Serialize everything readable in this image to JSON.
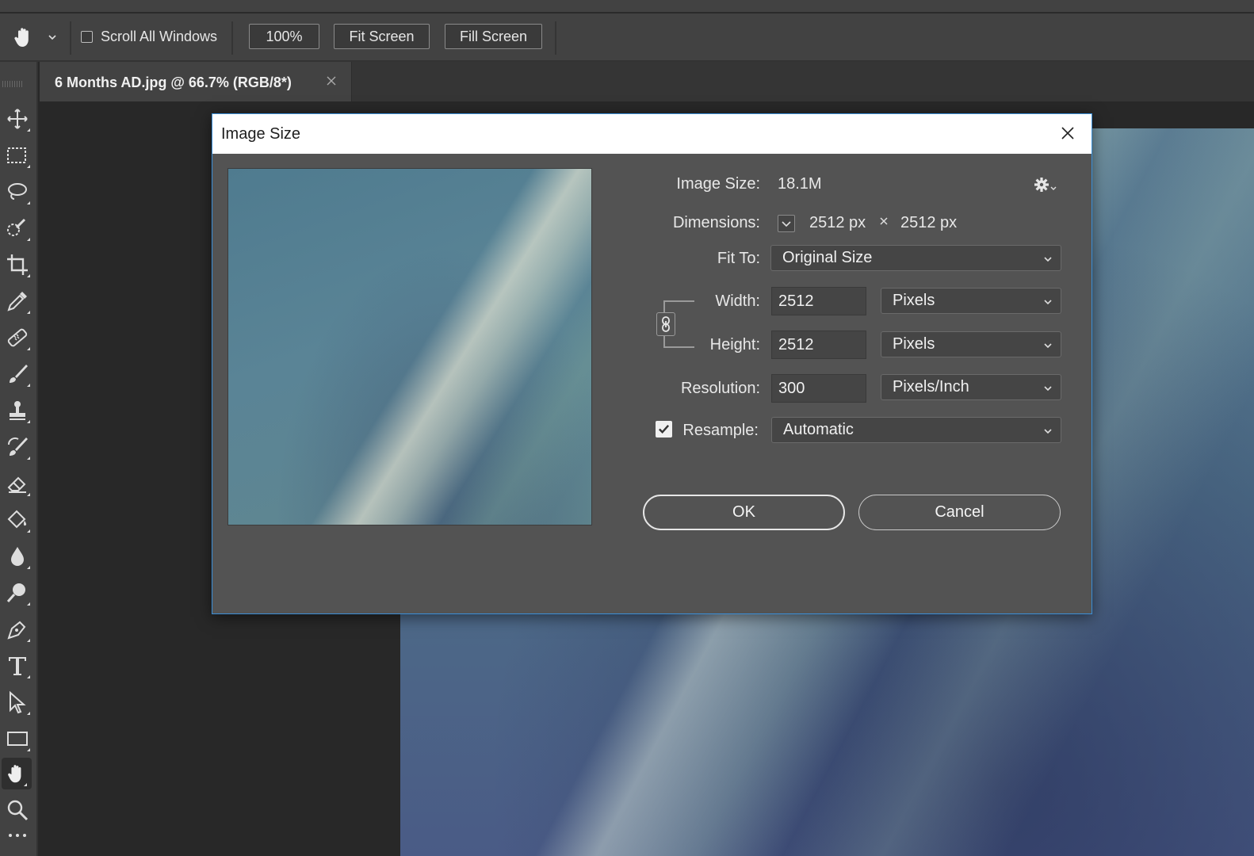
{
  "options_bar": {
    "scroll_all_label": "Scroll All Windows",
    "zoom_100_label": "100%",
    "fit_screen_label": "Fit Screen",
    "fill_screen_label": "Fill Screen"
  },
  "document_tab": {
    "title": "6 Months AD.jpg @ 66.7% (RGB/8*)"
  },
  "toolbar": {
    "tools": [
      "move-icon",
      "marquee-icon",
      "lasso-icon",
      "quick-select-icon",
      "crop-icon",
      "eyedropper-icon",
      "healing-icon",
      "brush-icon",
      "stamp-icon",
      "history-brush-icon",
      "eraser-icon",
      "paint-bucket-icon",
      "blur-icon",
      "dodge-icon",
      "pen-icon",
      "type-icon",
      "path-select-icon",
      "rectangle-icon",
      "hand-icon",
      "zoom-icon"
    ],
    "active_tool": "hand-icon"
  },
  "dialog": {
    "title": "Image Size",
    "image_size_label": "Image Size:",
    "image_size_value": "18.1M",
    "dimensions_label": "Dimensions:",
    "dimensions_width": "2512 px",
    "dimensions_height": "2512 px",
    "fit_to_label": "Fit To:",
    "fit_to_value": "Original Size",
    "width_label": "Width:",
    "width_value": "2512",
    "width_unit": "Pixels",
    "height_label": "Height:",
    "height_value": "2512",
    "height_unit": "Pixels",
    "resolution_label": "Resolution:",
    "resolution_value": "300",
    "resolution_unit": "Pixels/Inch",
    "resample_label": "Resample:",
    "resample_checked": true,
    "resample_value": "Automatic",
    "ok_label": "OK",
    "cancel_label": "Cancel"
  },
  "colors": {
    "dialog_border": "#3b8fd8",
    "panel_bg": "#535353",
    "chrome_bg": "#424242",
    "canvas_bg": "#282828"
  }
}
